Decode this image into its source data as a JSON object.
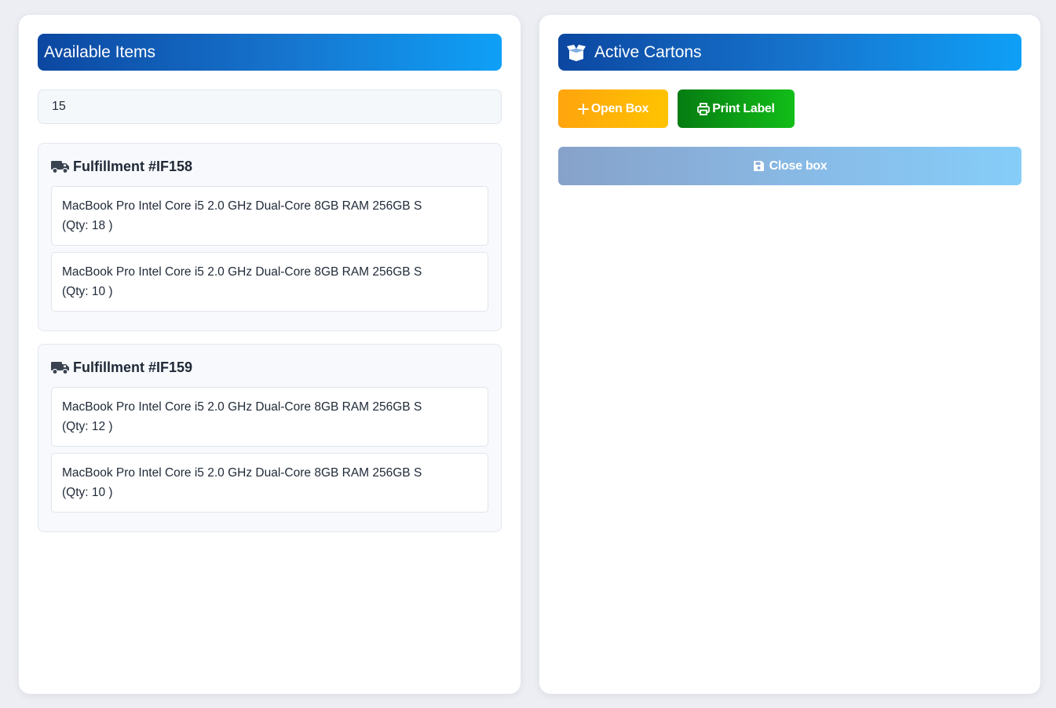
{
  "left": {
    "title": "Available Items",
    "search_value": "15",
    "fulfillments": [
      {
        "title": "Fulfillment #IF158",
        "items": [
          {
            "name": "MacBook Pro Intel Core i5 2.0 GHz Dual-Core 8GB RAM 256GB S",
            "qty": "(Qty: 18 )"
          },
          {
            "name": "MacBook Pro Intel Core i5 2.0 GHz Dual-Core 8GB RAM 256GB S",
            "qty": "(Qty: 10 )"
          }
        ]
      },
      {
        "title": "Fulfillment #IF159",
        "items": [
          {
            "name": "MacBook Pro Intel Core i5 2.0 GHz Dual-Core 8GB RAM 256GB S",
            "qty": "(Qty: 12 )"
          },
          {
            "name": "MacBook Pro Intel Core i5 2.0 GHz Dual-Core 8GB RAM 256GB S",
            "qty": "(Qty: 10 )"
          }
        ]
      }
    ]
  },
  "right": {
    "title": "Active Cartons",
    "open_box_label": "Open Box",
    "print_label_label": "Print Label",
    "close_box_label": "Close box"
  },
  "icons": {
    "header_left": "",
    "header_right": "box-open-icon",
    "fulfillment": "truck-icon",
    "open_box": "plus-icon",
    "print_label": "printer-icon",
    "close_box": "save-icon"
  },
  "colors": {
    "header_start": "#0c47a1",
    "header_end": "#0fa0f7",
    "open_box_start": "#ffa40e",
    "open_box_end": "#ffc300",
    "print_start": "#067c12",
    "print_end": "#12be18",
    "close_start": "#87a2ca",
    "close_end": "#86cdf9"
  }
}
